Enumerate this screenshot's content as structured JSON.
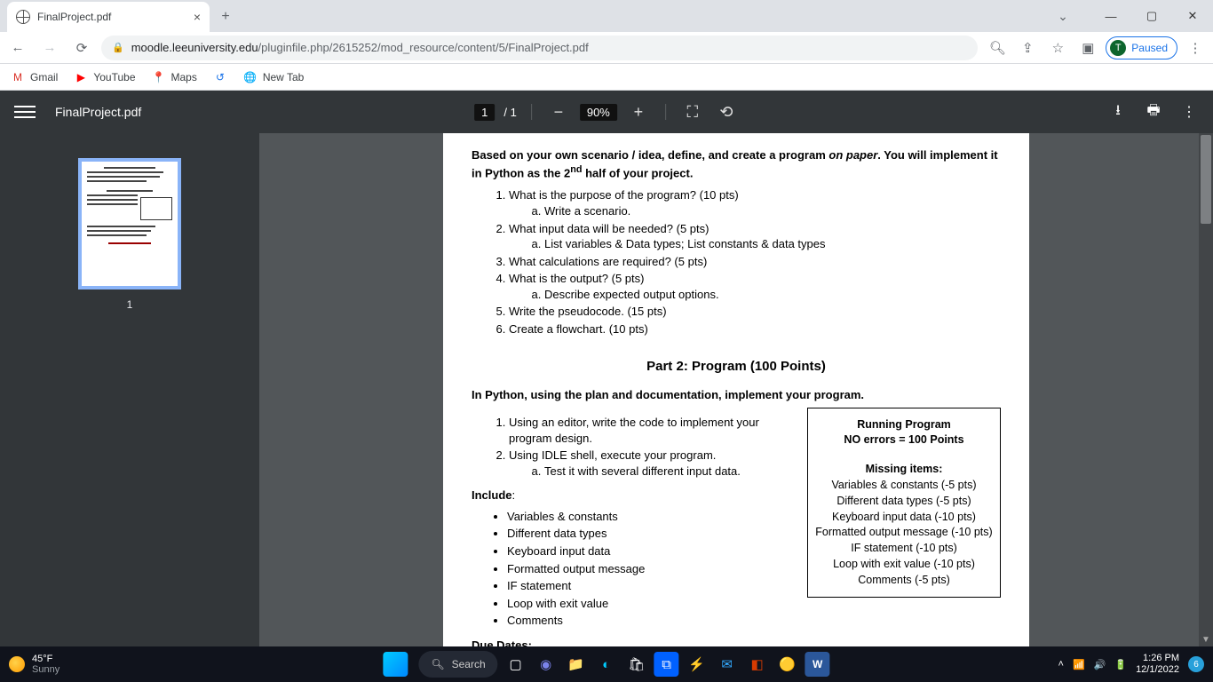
{
  "browser": {
    "tab_title": "FinalProject.pdf",
    "url_domain": "moodle.leeuniversity.edu",
    "url_path": "/pluginfile.php/2615252/mod_resource/content/5/FinalProject.pdf",
    "paused_label": "Paused",
    "paused_initial": "T",
    "bookmarks": [
      "Gmail",
      "YouTube",
      "Maps",
      "",
      "New Tab"
    ]
  },
  "pdf_toolbar": {
    "title": "FinalProject.pdf",
    "page_current": "1",
    "page_total": "1",
    "zoom": "90%",
    "thumb_num": "1"
  },
  "doc": {
    "intro_a": "Based on your own scenario / idea, define, and create a program ",
    "intro_b": "on paper",
    "intro_c": ". You will implement it in Python as the 2",
    "intro_sup": "nd",
    "intro_d": " half of your project.",
    "q1": "What is the purpose of the program? (10 pts)",
    "q1a": "Write a scenario.",
    "q2": "What input data will be needed? (5 pts)",
    "q2a": "List variables & Data types; List constants & data types",
    "q3": "What calculations are required? (5 pts)",
    "q4": "What is the output? (5 pts)",
    "q4a": "Describe expected output options.",
    "q5": "Write the pseudocode. (15 pts)",
    "q6": "Create a flowchart. (10 pts)",
    "part2_h": "Part 2: Program (100 Points)",
    "part2_intro": "In Python, using the plan and documentation, implement your program.",
    "p2_1": "Using an editor, write the code to implement your program design.",
    "p2_2": "Using IDLE shell, execute your program.",
    "p2_2a": "Test it with several different input data.",
    "include_h": "Include",
    "inc": [
      "Variables & constants",
      "Different data types",
      "Keyboard input data",
      "Formatted output message",
      "IF statement",
      "Loop with exit value",
      "Comments"
    ],
    "due_h": "Due Dates:",
    "rubric_h1": "Running Program",
    "rubric_h2": "NO errors = 100 Points",
    "rubric_mi": "Missing items:",
    "rubric_rows": [
      "Variables & constants (-5 pts)",
      "Different data types (-5 pts)",
      "Keyboard input data (-10 pts)",
      "Formatted output message (-10 pts)",
      "IF statement (-10 pts)",
      "Loop with exit value (-10 pts)",
      "Comments (-5 pts)"
    ]
  },
  "taskbar": {
    "temp": "45°F",
    "cond": "Sunny",
    "search": "Search",
    "time": "1:26 PM",
    "date": "12/1/2022",
    "notif": "6"
  }
}
